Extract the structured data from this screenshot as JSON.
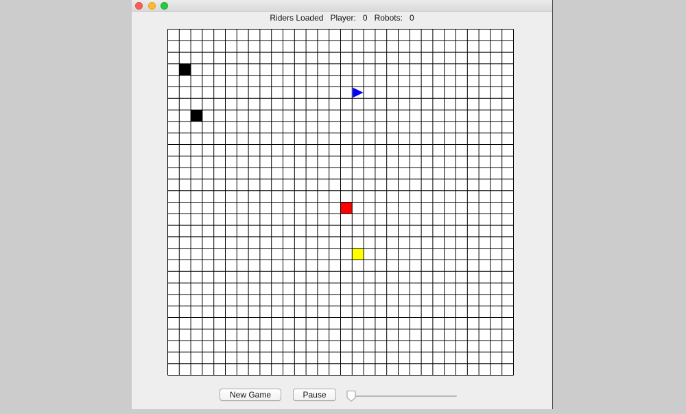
{
  "window": {
    "traffic_lights": [
      "close",
      "minimize",
      "zoom"
    ],
    "colors": {
      "close": "#fc5f57",
      "minimize": "#fdbc2e",
      "zoom": "#28c840"
    }
  },
  "status": {
    "prefix": "Riders Loaded",
    "player_label": "Player:",
    "player_value": "0",
    "robots_label": "Robots:",
    "robots_value": "0"
  },
  "board": {
    "rows": 30,
    "cols": 30,
    "grid_color": "#000000",
    "background": "#ffffff",
    "pieces": [
      {
        "name": "obstacle",
        "row": 3,
        "col": 1,
        "color": "#000000",
        "shape": "square"
      },
      {
        "name": "obstacle",
        "row": 7,
        "col": 2,
        "color": "#000000",
        "shape": "square"
      },
      {
        "name": "player-arrow",
        "row": 5,
        "col": 16,
        "color": "#0000ff",
        "shape": "triangle-right"
      },
      {
        "name": "red-robot",
        "row": 15,
        "col": 15,
        "color": "#ff0000",
        "shape": "square"
      },
      {
        "name": "yellow-rider",
        "row": 19,
        "col": 16,
        "color": "#ffff00",
        "shape": "square"
      }
    ]
  },
  "controls": {
    "new_game_label": "New Game",
    "pause_label": "Pause",
    "speed_slider": {
      "min": 0,
      "max": 100,
      "value": 0
    }
  }
}
